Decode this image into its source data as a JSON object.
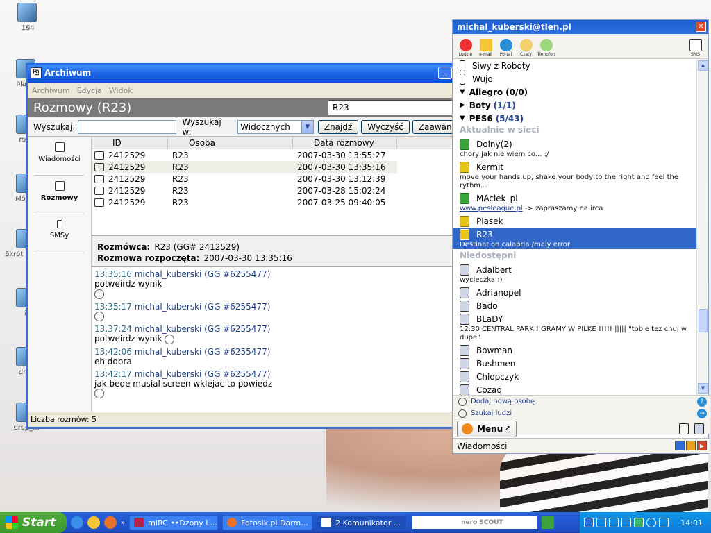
{
  "desktop": {
    "icons": [
      {
        "label": "164"
      },
      {
        "label": "Magic"
      },
      {
        "label": "rozn"
      },
      {
        "label": "Mój ko"
      },
      {
        "label": "Skrót d dysk"
      },
      {
        "label": "K"
      },
      {
        "label": "drop"
      },
      {
        "label": "drop_..."
      }
    ]
  },
  "archive": {
    "title": "Archiwum",
    "menu": [
      "Archiwum",
      "Edycja",
      "Widok"
    ],
    "header": "Rozmowy (R23)",
    "header_field": "R23",
    "search": {
      "label": "Wyszukaj:",
      "value": "",
      "in_label": "Wyszukaj w:",
      "in_value": "Widocznych",
      "find_btn": "Znajdź",
      "clear_btn": "Wyczyść",
      "advanced_btn": "Zaawans"
    },
    "nav": [
      {
        "label": "Wiadomości"
      },
      {
        "label": "Rozmowy"
      },
      {
        "label": "SMSy"
      }
    ],
    "columns": [
      "ID",
      "Osoba",
      "Data rozmowy"
    ],
    "rows": [
      {
        "id": "2412529",
        "osoba": "R23",
        "data": "2007-03-30 13:55:27"
      },
      {
        "id": "2412529",
        "osoba": "R23",
        "data": "2007-03-30 13:35:16"
      },
      {
        "id": "2412529",
        "osoba": "R23",
        "data": "2007-03-30 13:12:39"
      },
      {
        "id": "2412529",
        "osoba": "R23",
        "data": "2007-03-28 15:02:24"
      },
      {
        "id": "2412529",
        "osoba": "R23",
        "data": "2007-03-25 09:40:05"
      }
    ],
    "conv": {
      "rozmowca_label": "Rozmówca:",
      "rozmowca_value": "R23 (GG# 2412529)",
      "start_label": "Rozmowa rozpoczęta:",
      "start_value": "2007-03-30 13:35:16"
    },
    "messages": [
      {
        "time": "13:35:16",
        "author": "michal_kuberski (GG #6255477)",
        "text": "potweirdz wynik"
      },
      {
        "time": "13:35:17",
        "author": "michal_kuberski (GG #6255477)",
        "text": ""
      },
      {
        "time": "13:37:24",
        "author": "michal_kuberski (GG #6255477)",
        "text": "potweirdz wynik"
      },
      {
        "time": "13:42:06",
        "author": "michal_kuberski (GG #6255477)",
        "text": "eh dobra"
      },
      {
        "time": "13:42:17",
        "author": "michal_kuberski (GG #6255477)",
        "text": "jak bede musial screen wklejac to powiedz"
      }
    ],
    "status": "Liczba rozmów: 5"
  },
  "tlen": {
    "title": "michal_kuberski@tlen.pl",
    "toolbar": [
      {
        "label": "Ludzie"
      },
      {
        "label": "e-mail"
      },
      {
        "label": "Portal"
      },
      {
        "label": "Czaty"
      },
      {
        "label": "Tlenofon"
      },
      {
        "label": "SMS"
      }
    ],
    "top_contacts": [
      "Siwy z Roboty",
      "Wujo"
    ],
    "groups": [
      {
        "name": "Allegro",
        "count": "(0/0)"
      },
      {
        "name": "Boty",
        "count": "(1/1)"
      },
      {
        "name": "PES6",
        "count": "(5/43)"
      }
    ],
    "online_header": "Aktualnie w sieci",
    "online": [
      {
        "name": "Dolny(2)",
        "desc": "chory jak nie wiem co... :/"
      },
      {
        "name": "Kermit",
        "desc": "move your hands up, shake your body to the right and feel the rythm..."
      },
      {
        "name": "MAciek_pl",
        "desc_link": "www.pesleague.pl",
        "desc": " -> zapraszamy na irca"
      },
      {
        "name": "Plasek",
        "desc": ""
      },
      {
        "name": "R23",
        "desc": "Destination calabria    /maly error"
      }
    ],
    "offline_header": "Niedostępni",
    "offline": [
      {
        "name": "Adalbert",
        "desc": "wycieczka :)"
      },
      {
        "name": "Adrianopel",
        "desc": ""
      },
      {
        "name": "Bado",
        "desc": ""
      },
      {
        "name": "BLaDY",
        "desc": "12:30 CENTRAL PARK ! GRAMY W PILKE !!!!! ||||| \"tobie tez chuj w dupe\""
      },
      {
        "name": "Bowman",
        "desc": ""
      },
      {
        "name": "Bushmen",
        "desc": ""
      },
      {
        "name": "Chlopczyk",
        "desc": ""
      },
      {
        "name": "Cozaq",
        "desc": ""
      }
    ],
    "add_person": "Dodaj nową osobę",
    "search_people": "Szukaj ludzi",
    "menu_btn": "Menu",
    "status_label": "Wiadomości"
  },
  "taskbar": {
    "start": "Start",
    "tasks": [
      "mIRC ••Dzony L...",
      "Fotosik.pl Darm...",
      "2 Komunikator ..."
    ],
    "search_brand": "nero SCOUT",
    "clock": "14:01"
  }
}
